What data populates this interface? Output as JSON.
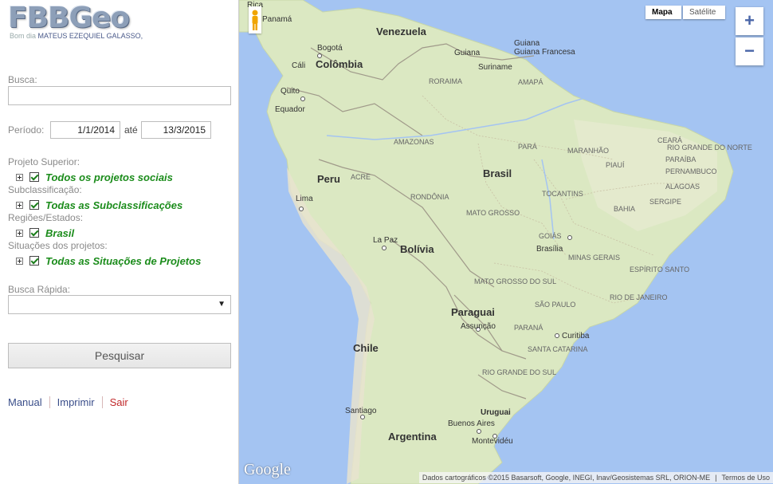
{
  "app": {
    "logo": "FBBGeo",
    "greeting": "Bom dia",
    "user": "MATEUS EZEQUIEL GALASSO,"
  },
  "search": {
    "label": "Busca:",
    "value": ""
  },
  "period": {
    "label": "Período:",
    "start": "1/1/2014",
    "sep": "até",
    "end": "13/3/2015"
  },
  "filters": [
    {
      "heading": "Projeto Superior:",
      "item": "Todos os projetos sociais"
    },
    {
      "heading": "Subclassificação:",
      "item": "Todas as Subclassificações"
    },
    {
      "heading": "Regiões/Estados:",
      "item": "Brasil"
    },
    {
      "heading": "Situações dos projetos:",
      "item": "Todas as Situações de Projetos"
    }
  ],
  "quick": {
    "label": "Busca Rápida:",
    "value": ""
  },
  "search_button": "Pesquisar",
  "footer_links": {
    "manual": "Manual",
    "print": "Imprimir",
    "exit": "Sair"
  },
  "map": {
    "type_map": "Mapa",
    "type_satellite": "Satélite",
    "zoom_in": "+",
    "zoom_out": "−",
    "google": "Google",
    "attribution": "Dados cartográficos ©2015 Basarsoft, Google, INEGI, Inav/Geosistemas SRL, ORION-ME",
    "terms": "Termos de Uso",
    "labels": {
      "panama": "Panamá",
      "costa_rica": "Rica",
      "venezuela": "Venezuela",
      "bogota": "Bogotá",
      "colombia": "Colômbia",
      "guiana": "Guiana",
      "guiana_francesa": "Guiana Francesa",
      "suriname": "Suriname",
      "roraima": "RORAIMA",
      "amapa": "AMAPÁ",
      "cali": "Cáli",
      "quito": "Quito",
      "equador": "Equador",
      "amazonas": "AMAZONAS",
      "para": "PARÁ",
      "maranhao": "MARANHÃO",
      "ceara": "CEARÁ",
      "rio_grande_do_norte": "RIO GRANDE DO NORTE",
      "brasil": "Brasil",
      "piaui": "PIAUÍ",
      "paraiba": "PARAÍBA",
      "pernambuco": "PERNAMBUCO",
      "alagoas": "ALAGOAS",
      "peru": "Peru",
      "acre": "ACRE",
      "rondonia": "RONDÔNIA",
      "tocantins": "TOCANTINS",
      "sergipe": "SERGIPE",
      "lima": "Lima",
      "mato_grosso": "MATO GROSSO",
      "bahia": "BAHIA",
      "goias": "GOIÁS",
      "la_paz": "La Paz",
      "bolivia": "Bolívia",
      "brasilia": "Brasília",
      "minas_gerais": "MINAS GERAIS",
      "espirito_santo": "ESPÍRITO SANTO",
      "mato_grosso_do_sul": "MATO GROSSO DO SUL",
      "sao_paulo": "SÃO PAULO",
      "rio_de_janeiro": "RIO DE JANEIRO",
      "paraguai": "Paraguai",
      "assuncao": "Assunção",
      "parana": "PARANÁ",
      "curitiba": "Curitiba",
      "chile": "Chile",
      "santa_catarina": "SANTA CATARINA",
      "rio_grande_do_sul": "RIO GRANDE DO SUL",
      "uruguai": "Uruguai",
      "santiago": "Santiago",
      "buenos_aires": "Buenos Aires",
      "montevideu": "Montevidéu",
      "argentina": "Argentina"
    }
  }
}
